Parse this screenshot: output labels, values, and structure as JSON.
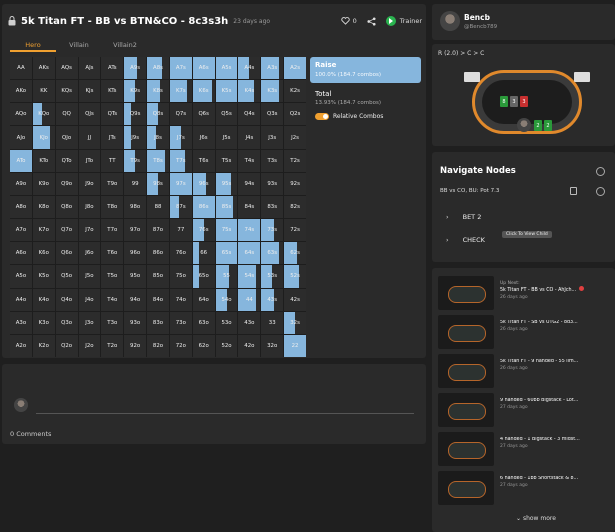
{
  "header": {
    "title": "5k Titan FT - BB vs BTN&CO - 8c3s3h",
    "age": "23 days ago",
    "likes": "0",
    "trainer_label": "Trainer"
  },
  "tabs": [
    {
      "label": "Hero",
      "active": true
    },
    {
      "label": "Villain",
      "active": false
    },
    {
      "label": "Villain2",
      "active": false
    }
  ],
  "range": {
    "raise_label": "Raise",
    "raise_detail": "100.0% (184.7 combos)",
    "total_label": "Total",
    "total_detail": "13.93% (184.7 combos)",
    "relative_label": "Relative Combos",
    "accent": "#86b6dd",
    "hands": [
      [
        "AA",
        "AKs",
        "AQs",
        "AJs",
        "ATs",
        "A9s",
        "A8s",
        "A7s",
        "A6s",
        "A5s",
        "A4s",
        "A3s",
        "A2s"
      ],
      [
        "AKo",
        "KK",
        "KQs",
        "KJs",
        "KTs",
        "K9s",
        "K8s",
        "K7s",
        "K6s",
        "K5s",
        "K4s",
        "K3s",
        "K2s"
      ],
      [
        "AQo",
        "KQo",
        "QQ",
        "QJs",
        "QTs",
        "Q9s",
        "Q8s",
        "Q7s",
        "Q6s",
        "Q5s",
        "Q4s",
        "Q3s",
        "Q2s"
      ],
      [
        "AJo",
        "KJo",
        "QJo",
        "JJ",
        "JTs",
        "J9s",
        "J8s",
        "J7s",
        "J6s",
        "J5s",
        "J4s",
        "J3s",
        "J2s"
      ],
      [
        "ATo",
        "KTo",
        "QTo",
        "JTo",
        "TT",
        "T9s",
        "T8s",
        "T7s",
        "T6s",
        "T5s",
        "T4s",
        "T3s",
        "T2s"
      ],
      [
        "A9o",
        "K9o",
        "Q9o",
        "J9o",
        "T9o",
        "99",
        "98s",
        "97s",
        "96s",
        "95s",
        "94s",
        "93s",
        "92s"
      ],
      [
        "A8o",
        "K8o",
        "Q8o",
        "J8o",
        "T8o",
        "98o",
        "88",
        "87s",
        "86s",
        "85s",
        "84s",
        "83s",
        "82s"
      ],
      [
        "A7o",
        "K7o",
        "Q7o",
        "J7o",
        "T7o",
        "97o",
        "87o",
        "77",
        "76s",
        "75s",
        "74s",
        "73s",
        "72s"
      ],
      [
        "A6o",
        "K6o",
        "Q6o",
        "J6o",
        "T6o",
        "96o",
        "86o",
        "76o",
        "66",
        "65s",
        "64s",
        "63s",
        "62s"
      ],
      [
        "A5o",
        "K5o",
        "Q5o",
        "J5o",
        "T5o",
        "95o",
        "85o",
        "75o",
        "65o",
        "55",
        "54s",
        "53s",
        "52s"
      ],
      [
        "A4o",
        "K4o",
        "Q4o",
        "J4o",
        "T4o",
        "94o",
        "84o",
        "74o",
        "64o",
        "54o",
        "44",
        "43s",
        "42s"
      ],
      [
        "A3o",
        "K3o",
        "Q3o",
        "J3o",
        "T3o",
        "93o",
        "83o",
        "73o",
        "63o",
        "53o",
        "43o",
        "33",
        "32s"
      ],
      [
        "A2o",
        "K2o",
        "Q2o",
        "J2o",
        "T2o",
        "92o",
        "82o",
        "72o",
        "62o",
        "52o",
        "42o",
        "32o",
        "22"
      ]
    ],
    "freq": [
      [
        0,
        0,
        0,
        0,
        0,
        0.6,
        0.7,
        1,
        1,
        1,
        0.5,
        0.8,
        1
      ],
      [
        0,
        0,
        0,
        0,
        0,
        0.5,
        0.6,
        0.8,
        0.9,
        1,
        0.7,
        0.8,
        0
      ],
      [
        0,
        0.4,
        0,
        0,
        0,
        0.3,
        0.5,
        0,
        0,
        0,
        0,
        0,
        0
      ],
      [
        0,
        0.8,
        0,
        0,
        0,
        0.3,
        0.4,
        0.5,
        0,
        0,
        0,
        0,
        0
      ],
      [
        1,
        0,
        0,
        0,
        0,
        0.5,
        0.8,
        0.7,
        0,
        0,
        0,
        0,
        0
      ],
      [
        0,
        0,
        0,
        0,
        0,
        0,
        0.5,
        1,
        0.6,
        0.7,
        0,
        0,
        0
      ],
      [
        0,
        0,
        0,
        0,
        0,
        0,
        0,
        0.4,
        1,
        0.8,
        0,
        0,
        0
      ],
      [
        0,
        0,
        0,
        0,
        0,
        0,
        0,
        0,
        0.5,
        1,
        1,
        0.6,
        0
      ],
      [
        0,
        0,
        0,
        0,
        0,
        0,
        0,
        0,
        0.3,
        1,
        1,
        0.8,
        0.6
      ],
      [
        0,
        0,
        0,
        0,
        0,
        0,
        0,
        0,
        0.3,
        0.6,
        0.8,
        0.5,
        0.7
      ],
      [
        0,
        0,
        0,
        0,
        0,
        0,
        0,
        0,
        0,
        0.5,
        0.8,
        0.6,
        0
      ],
      [
        0,
        0,
        0,
        0,
        0,
        0,
        0,
        0,
        0,
        0,
        0,
        0,
        0.5
      ],
      [
        0,
        0,
        0,
        0,
        0,
        0,
        0,
        0,
        0,
        0,
        0,
        0,
        1
      ]
    ]
  },
  "comments": {
    "count_label": "0 Comments"
  },
  "user": {
    "name": "Bencb",
    "handle": "@Bencb789"
  },
  "table": {
    "action_path": "R (2.0) > C > C",
    "board": [
      "8",
      "3",
      "3"
    ],
    "hero_cards": [
      "2",
      "2"
    ]
  },
  "nav": {
    "title": "Navigate Nodes",
    "path": "BB vs CO, BU: Pot 7.3",
    "items": [
      {
        "label": "BET 2"
      },
      {
        "label": "CHECK"
      }
    ],
    "tooltip": "Click To View Child"
  },
  "related": {
    "items": [
      {
        "up_next": "Up Next:",
        "title": "5k Titan FT - BB vs CO - AhJch...",
        "date": "26 days ago"
      },
      {
        "up_next": "",
        "title": "5k Titan FT - SB vs UTG2 - 8d3...",
        "date": "26 days ago"
      },
      {
        "up_next": "",
        "title": "5k Titan FT - 9 handed - 55 lim...",
        "date": "26 days ago"
      },
      {
        "up_next": "",
        "title": "9 handed - 60bb Bigstack - Lot...",
        "date": "27 days ago"
      },
      {
        "up_next": "",
        "title": "4 handed - 1 Bigstack - 3 midst...",
        "date": "27 days ago"
      },
      {
        "up_next": "",
        "title": "6 handed - 1bb Shortstack & 8...",
        "date": "27 days ago"
      }
    ],
    "show_more": "show more"
  }
}
